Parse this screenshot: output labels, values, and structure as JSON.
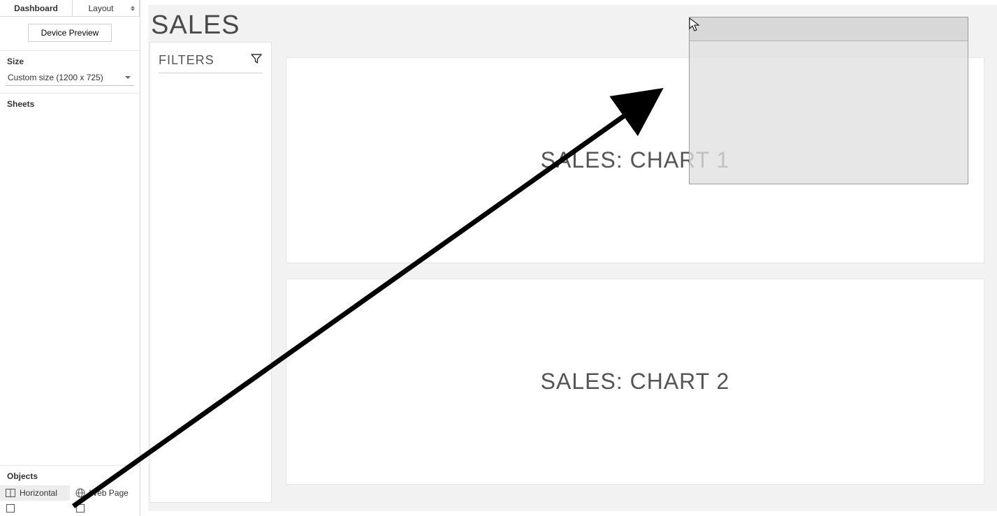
{
  "tabs": {
    "dashboard": "Dashboard",
    "layout": "Layout"
  },
  "device_preview": "Device Preview",
  "size": {
    "header": "Size",
    "value": "Custom size (1200 x 725)"
  },
  "sheets": {
    "header": "Sheets"
  },
  "objects": {
    "header": "Objects",
    "horizontal": "Horizontal",
    "webpage": "Web Page"
  },
  "dashboard": {
    "title": "SALES",
    "filters_label": "FILTERS",
    "chart1": "SALES: CHART 1",
    "chart2": "SALES: CHART 2"
  }
}
